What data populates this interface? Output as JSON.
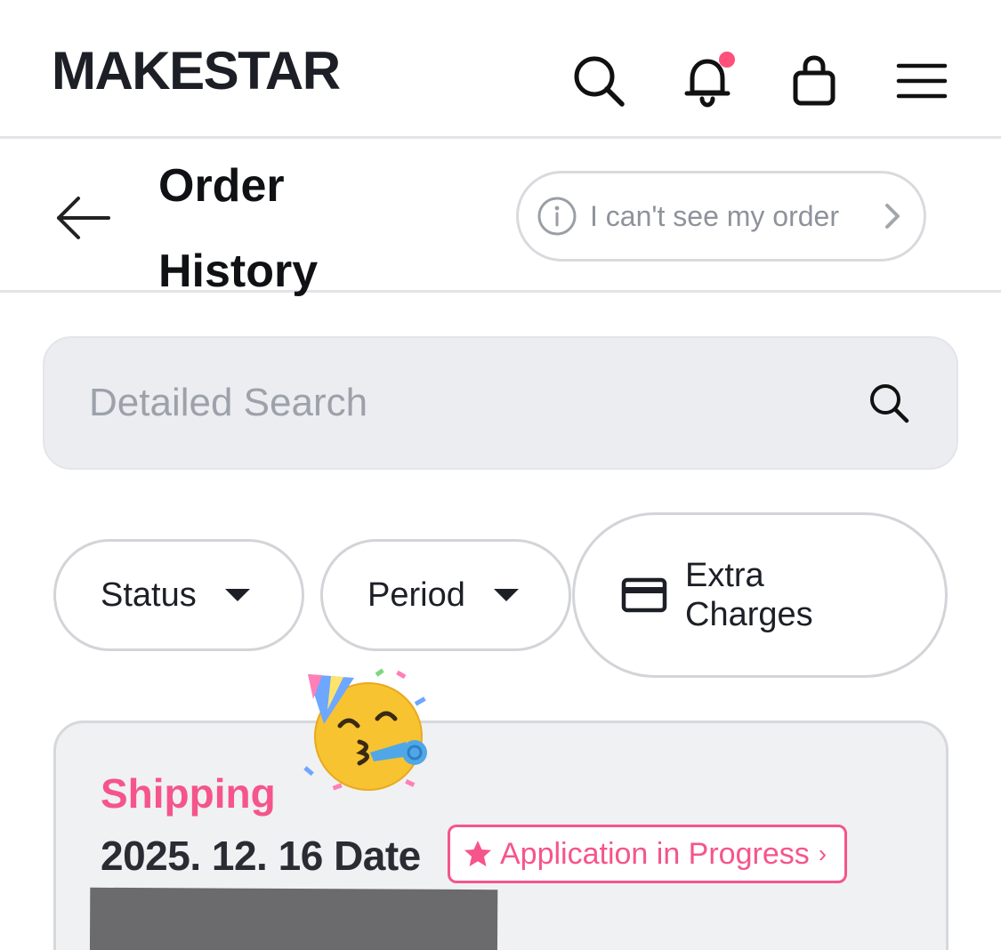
{
  "header": {
    "logo": "MAKESTAR",
    "icons": [
      "search-icon",
      "bell-icon",
      "shopping-bag-icon",
      "menu-icon"
    ],
    "notification_dot_color": "#ff4f7b"
  },
  "subheader": {
    "back_icon": "arrow-left-icon",
    "title": "Order History",
    "help_button": "I can't see my order"
  },
  "search": {
    "placeholder": "Detailed Search",
    "value": ""
  },
  "filters": {
    "status": "Status",
    "period": "Period",
    "extra_charges": "Extra Charges"
  },
  "order": {
    "status": "Shipping",
    "date": "2025. 12. 16 Date",
    "badge": "Application in Progress",
    "badge_chevron": "›"
  },
  "colors": {
    "accent_pink": "#f5558a",
    "search_bg": "#ebedf1",
    "card_bg": "#f0f1f3"
  }
}
